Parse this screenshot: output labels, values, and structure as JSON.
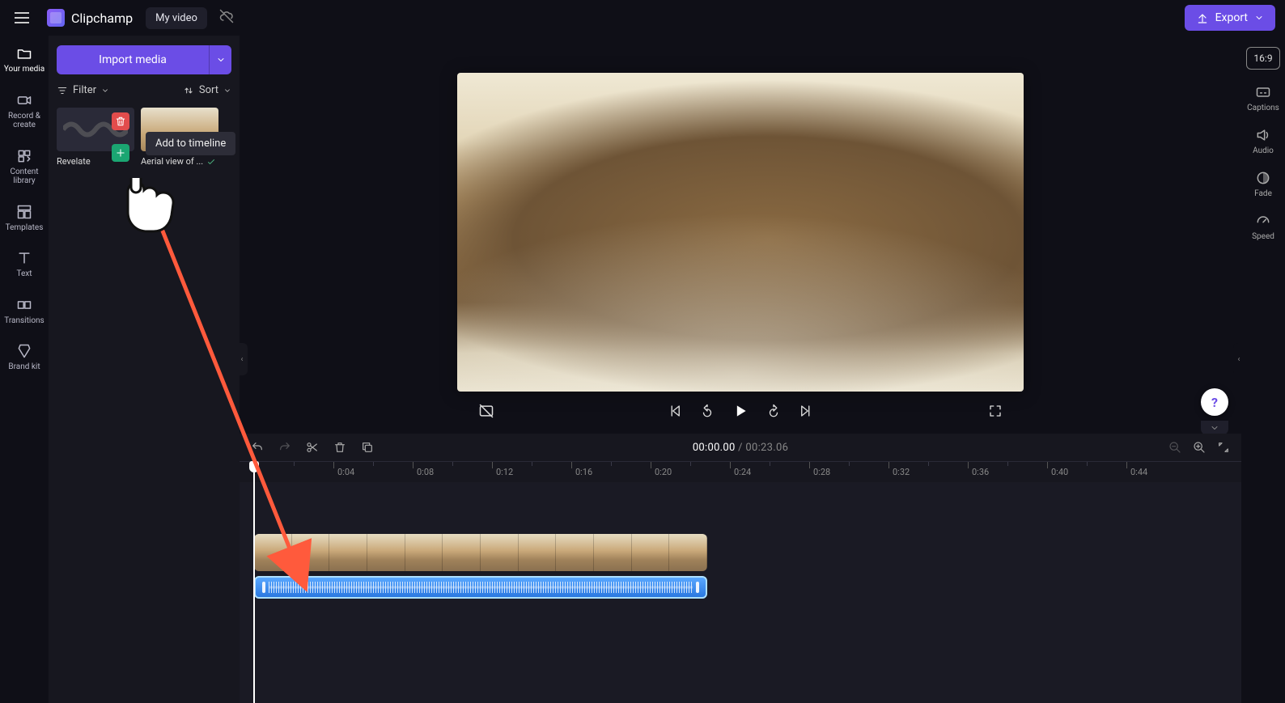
{
  "app_name": "Clipchamp",
  "project_title": "My video",
  "export_label": "Export",
  "rail": {
    "your_media": "Your media",
    "record_create": "Record & create",
    "content_library": "Content library",
    "templates": "Templates",
    "text": "Text",
    "transitions": "Transitions",
    "brand_kit": "Brand kit"
  },
  "media_pane": {
    "import_label": "Import media",
    "filter_label": "Filter",
    "sort_label": "Sort",
    "tooltip_add": "Add to timeline",
    "item1_name": "Revelate",
    "item2_name": "Aerial view of ..."
  },
  "aspect_ratio": "16:9",
  "rrail": {
    "captions": "Captions",
    "audio": "Audio",
    "fade": "Fade",
    "speed": "Speed"
  },
  "timecode": {
    "current": "00:00.00",
    "sep": " / ",
    "total": "00:23.06"
  },
  "ruler_labels": [
    "0:04",
    "0:08",
    "0:12",
    "0:16",
    "0:20",
    "0:24",
    "0:28",
    "0:32",
    "0:36",
    "0:40",
    "0:44"
  ],
  "help_label": "?"
}
